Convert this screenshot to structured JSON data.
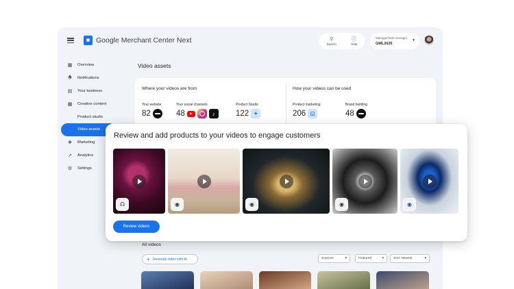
{
  "app": {
    "title": "Google Merchant Center Next"
  },
  "topbar": {
    "actions": [
      {
        "label": "Search",
        "icon": "search-icon"
      },
      {
        "label": "Help",
        "icon": "help-icon"
      }
    ],
    "account": {
      "role": "Manager/Sub-manager",
      "id": "GML2025"
    }
  },
  "sidebar": {
    "items": [
      {
        "label": "Overview",
        "icon": "overview-icon"
      },
      {
        "label": "Notifications",
        "icon": "bell-icon"
      },
      {
        "label": "Your business",
        "icon": "store-icon"
      },
      {
        "label": "Creative content",
        "icon": "grid-icon"
      },
      {
        "label": "Product studio",
        "icon": ""
      },
      {
        "label": "Video assets",
        "icon": "",
        "active": true
      },
      {
        "label": "Marketing",
        "icon": "megaphone-icon"
      },
      {
        "label": "Analytics",
        "icon": "trend-icon"
      },
      {
        "label": "Settings",
        "icon": "gear-icon"
      }
    ]
  },
  "main": {
    "page_title": "Video assets",
    "sources": {
      "title": "Where your videos are from",
      "stats": [
        {
          "label": "Your website",
          "value": "82"
        },
        {
          "label": "Your social channels",
          "value": "48"
        },
        {
          "label": "Product Studio",
          "value": "122"
        }
      ]
    },
    "usage": {
      "title": "How your videos can be used",
      "stats": [
        {
          "label": "Product marketing",
          "value": "206"
        },
        {
          "label": "Brand building",
          "value": "48"
        }
      ]
    },
    "all_videos": {
      "title": "All videos",
      "generate_label": "Generate video with AI",
      "filters": [
        {
          "label": "Sources"
        },
        {
          "label": "Featured"
        },
        {
          "label": "Sort: Newest"
        }
      ]
    }
  },
  "overlay": {
    "title": "Review and add products to your videos to engage customers",
    "button_label": "Review videos",
    "videos": [
      {
        "product": "headphones"
      },
      {
        "product": "earbuds"
      },
      {
        "product": "earbuds"
      },
      {
        "product": "earbuds"
      },
      {
        "product": "earbuds"
      }
    ]
  },
  "colors": {
    "accent": "#1a73e8",
    "background": "#f0f4f9"
  }
}
